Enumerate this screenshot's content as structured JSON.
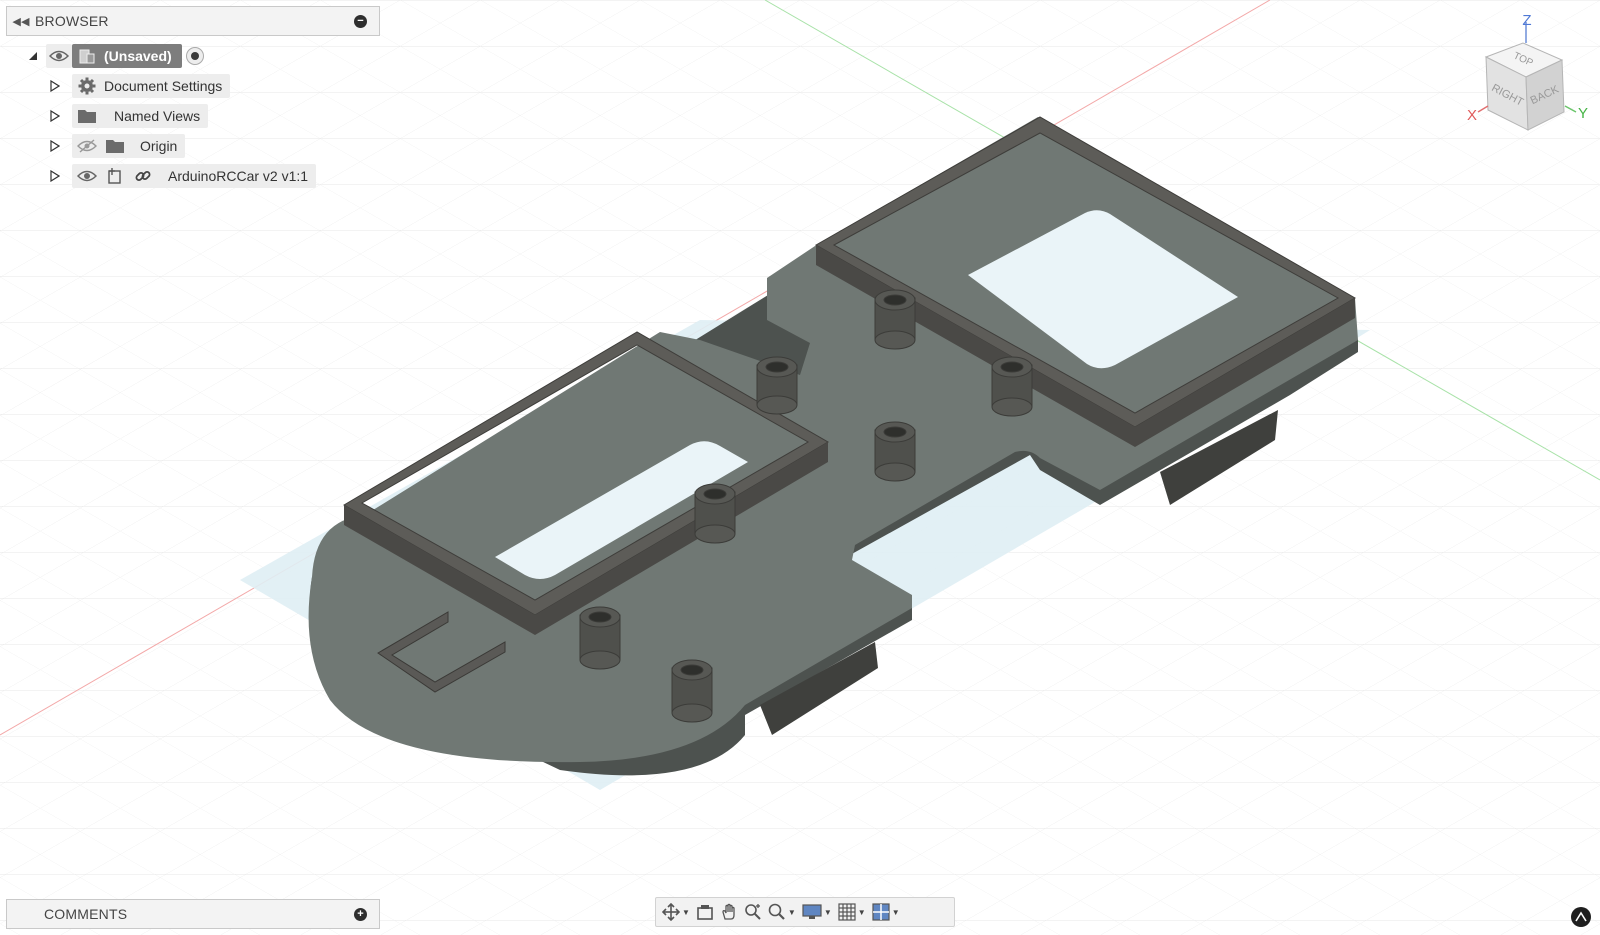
{
  "browser": {
    "title": "BROWSER",
    "root": {
      "label": "(Unsaved)"
    },
    "items": [
      {
        "label": "Document Settings",
        "icon": "gear-icon"
      },
      {
        "label": "Named Views",
        "icon": "folder-icon"
      },
      {
        "label": "Origin",
        "icon": "folder-icon",
        "visibility": "hidden"
      },
      {
        "label": "ArduinoRCCar v2 v1:1",
        "icon": "component-icon",
        "linked": true
      }
    ]
  },
  "comments": {
    "title": "COMMENTS"
  },
  "viewcube": {
    "axes": {
      "x": "X",
      "y": "Y",
      "z": "Z"
    },
    "faces": {
      "top": "TOP",
      "right": "RIGHT",
      "back": "BACK"
    }
  },
  "toolbar": {
    "items": [
      "orbit",
      "look-at",
      "pan",
      "zoom",
      "fit",
      "display-settings",
      "grid-settings",
      "viewports"
    ]
  },
  "colors": {
    "part_top": "#6f7773",
    "part_side": "#4f5451",
    "wall": "#5b5a56",
    "grid": "#e6e6e6",
    "shadow": "#cfe3ec",
    "axis_red": "#f3a3a3",
    "axis_green": "#a8e2a8"
  }
}
